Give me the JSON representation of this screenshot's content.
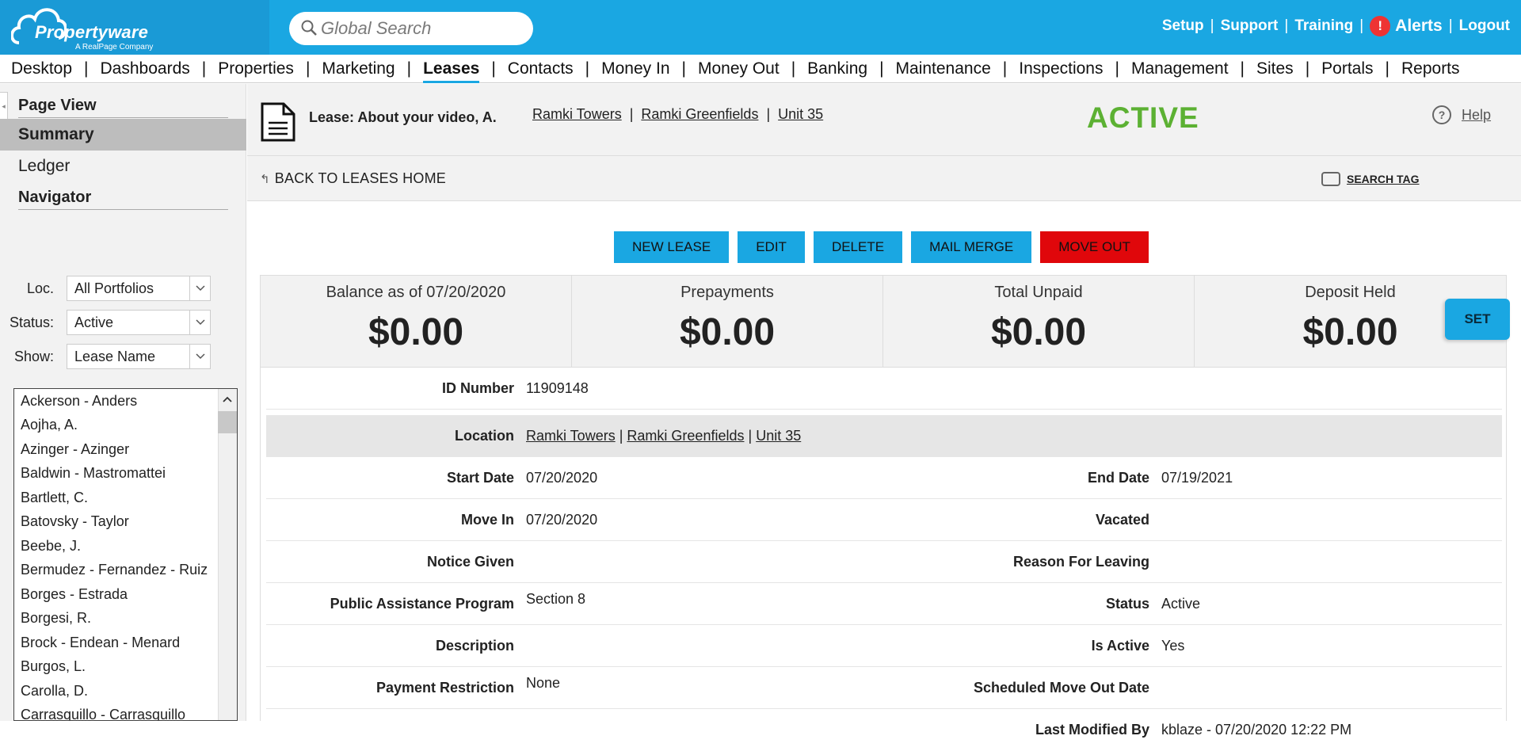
{
  "app": {
    "logo_text": "Propertyware",
    "logo_sub": "A RealPage Company"
  },
  "search": {
    "placeholder": "Global Search"
  },
  "toplinks": {
    "setup": "Setup",
    "support": "Support",
    "training": "Training",
    "alert_badge": "!",
    "alerts": "Alerts",
    "logout": "Logout",
    "sep": "|"
  },
  "nav": {
    "items": [
      "Desktop",
      "Dashboards",
      "Properties",
      "Marketing",
      "Leases",
      "Contacts",
      "Money In",
      "Money Out",
      "Banking",
      "Maintenance",
      "Inspections",
      "Management",
      "Sites",
      "Portals",
      "Reports"
    ],
    "active": "Leases",
    "sep": "|"
  },
  "sidebar": {
    "page_view_heading": "Page View",
    "views": [
      "Summary",
      "Ledger"
    ],
    "selected_view": "Summary",
    "navigator_heading": "Navigator",
    "filters": {
      "loc_label": "Loc.",
      "loc_value": "All Portfolios",
      "status_label": "Status:",
      "status_value": "Active",
      "show_label": "Show:",
      "show_value": "Lease Name"
    },
    "leases": [
      "Ackerson - Anders",
      "Aojha, A.",
      "Azinger - Azinger",
      "Baldwin - Mastromattei",
      "Bartlett, C.",
      "Batovsky - Taylor",
      "Beebe, J.",
      "Bermudez - Fernandez - Ruiz",
      "Borges - Estrada",
      "Borgesi, R.",
      "Brock - Endean - Menard",
      "Burgos, L.",
      "Carolla, D.",
      "Carrasquillo - Carrasquillo"
    ]
  },
  "header": {
    "lease_title": "Lease: About your video, A.",
    "crumbs": [
      "Ramki Towers",
      "Ramki Greenfields",
      "Unit 35"
    ],
    "crumb_sep": "|",
    "status": "ACTIVE",
    "status_color": "#5cb133",
    "help": "Help",
    "back": "BACK TO LEASES HOME",
    "search_tag": "SEARCH TAG"
  },
  "actions": {
    "new_lease": "NEW LEASE",
    "edit": "EDIT",
    "delete": "DELETE",
    "mail_merge": "MAIL MERGE",
    "move_out": "MOVE OUT",
    "accent": "#1aa7e2",
    "danger": "#e0070b"
  },
  "balances": [
    {
      "label": "Balance as of 07/20/2020",
      "amount": "$0.00"
    },
    {
      "label": "Prepayments",
      "amount": "$0.00"
    },
    {
      "label": "Total Unpaid",
      "amount": "$0.00"
    },
    {
      "label": "Deposit Held",
      "amount": "$0.00"
    }
  ],
  "set_button": "SET",
  "details": {
    "id_label": "ID Number",
    "id_value": "11909148",
    "location_label": "Location",
    "location_sep": "|",
    "start_label": "Start Date",
    "start_value": "07/20/2020",
    "end_label": "End Date",
    "end_value": "07/19/2021",
    "movein_label": "Move In",
    "movein_value": "07/20/2020",
    "vacated_label": "Vacated",
    "notice_label": "Notice Given",
    "reason_label": "Reason For Leaving",
    "pap_label": "Public Assistance Program",
    "pap_value": "Section 8",
    "status_label": "Status",
    "status_value": "Active",
    "description_label": "Description",
    "isactive_label": "Is Active",
    "isactive_value": "Yes",
    "payrestrict_label": "Payment Restriction",
    "payrestrict_value": "None",
    "scheduled_label": "Scheduled Move Out Date",
    "lastmod_label": "Last Modified By",
    "lastmod_value": "kblaze - 07/20/2020 12:22 PM"
  }
}
